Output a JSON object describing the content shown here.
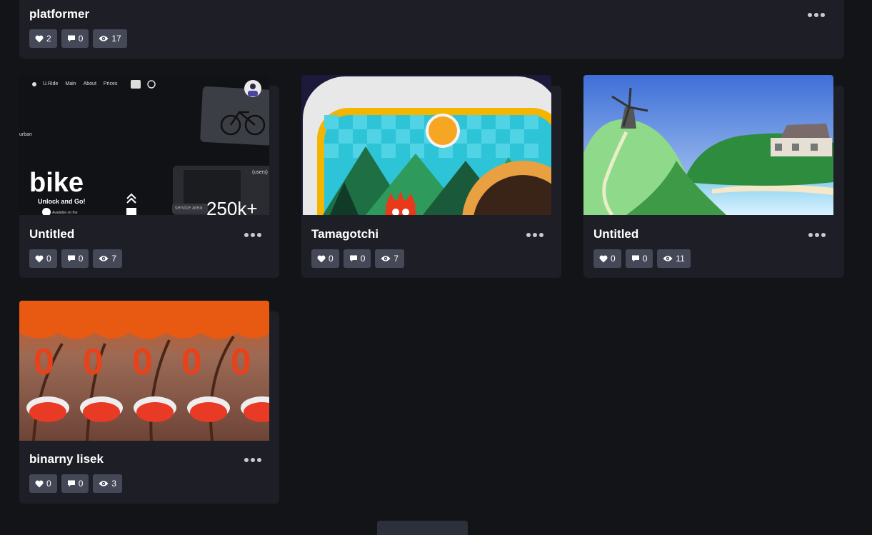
{
  "pens": [
    {
      "title": "platformer",
      "likes": "2",
      "comments": "0",
      "views": "17"
    },
    {
      "title": "Untitled",
      "likes": "0",
      "comments": "0",
      "views": "7",
      "preview": {
        "nav": [
          "U.Ride",
          "Main",
          "About",
          "Prices"
        ],
        "word": "urban",
        "headline": "bike",
        "tagline": "Unlock and Go!",
        "users": "(users)",
        "area": "service area",
        "count": "250k+",
        "small": "Available on the"
      }
    },
    {
      "title": "Tamagotchi",
      "likes": "0",
      "comments": "0",
      "views": "7"
    },
    {
      "title": "Untitled",
      "likes": "0",
      "comments": "0",
      "views": "11"
    },
    {
      "title": "binarny lisek",
      "likes": "0",
      "comments": "0",
      "views": "3",
      "preview": {
        "digits": [
          "0",
          "0",
          "0",
          "0",
          "0"
        ]
      }
    }
  ],
  "icons": {
    "like": "heart-icon",
    "comment": "comment-icon",
    "view": "eye-icon",
    "more": "more-dots-icon"
  },
  "colors": {
    "background": "#131417",
    "card": "#1e1f26",
    "chip": "#444857",
    "dots": "#c7c9d3"
  }
}
